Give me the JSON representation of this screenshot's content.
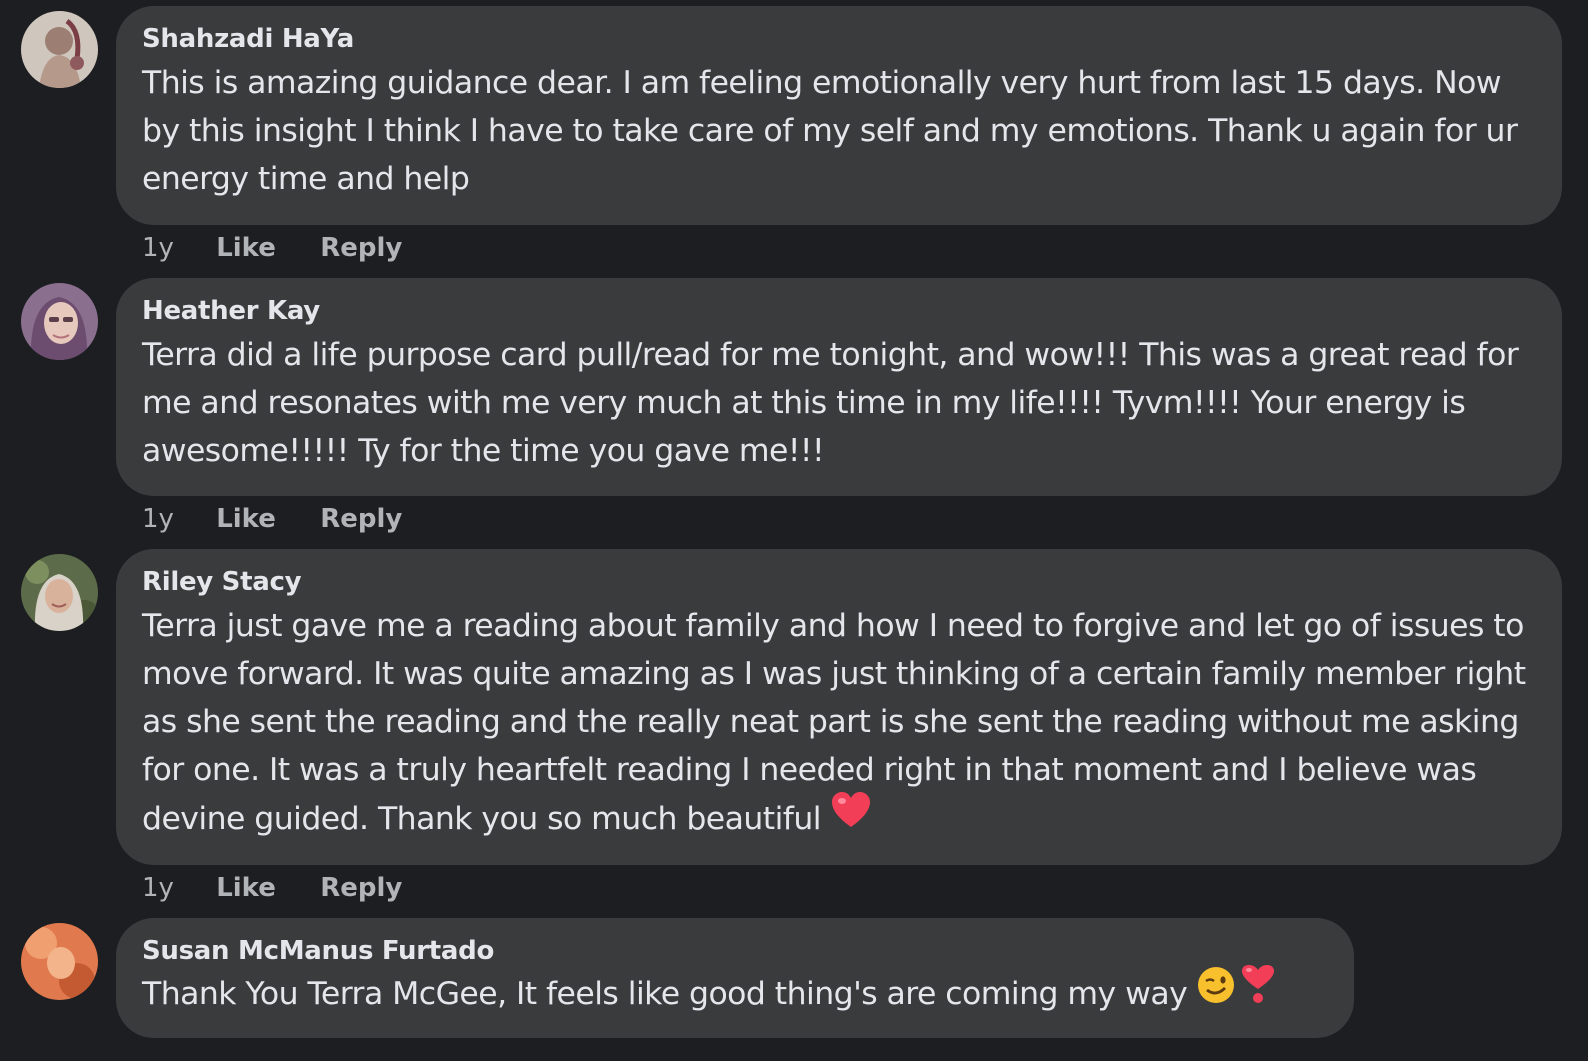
{
  "comments": [
    {
      "author": "Shahzadi HaYa",
      "text": "This is amazing guidance dear. I am feeling emotionally very hurt from last 15 days. Now by this insight I think I have to take care of my self and my emotions. Thank u again for ur energy time and help",
      "time": "1y",
      "like_label": "Like",
      "reply_label": "Reply"
    },
    {
      "author": "Heather Kay",
      "text": "Terra did a life purpose card pull/read for me tonight, and wow!!! This was a great read for me and resonates with me very much at this time in my life!!!! Tyvm!!!! Your energy is awesome!!!!! Ty for the time you gave me!!!",
      "time": "1y",
      "like_label": "Like",
      "reply_label": "Reply"
    },
    {
      "author": "Riley Stacy",
      "text": "Terra just gave me a reading about family and how I need to forgive and let go of issues to move forward. It was quite amazing as I was just thinking of a certain family member right as she sent the reading and the really neat part is she sent the reading without me asking for one. It was a truly heartfelt reading I needed right in that moment and I believe was devine guided. Thank you so much beautiful",
      "emojis": [
        "heart-emoji"
      ],
      "time": "1y",
      "like_label": "Like",
      "reply_label": "Reply"
    },
    {
      "author": "Susan McManus Furtado",
      "text": "Thank You Terra McGee, It feels like good thing's are coming my way",
      "emojis": [
        "wink-emoji",
        "heart-exclamation-emoji"
      ]
    }
  ],
  "colors": {
    "background": "#1c1e21",
    "bubble": "#3a3b3c",
    "text": "#e4e6eb",
    "secondary": "#b0b3b8",
    "heart": "#f33e58"
  }
}
